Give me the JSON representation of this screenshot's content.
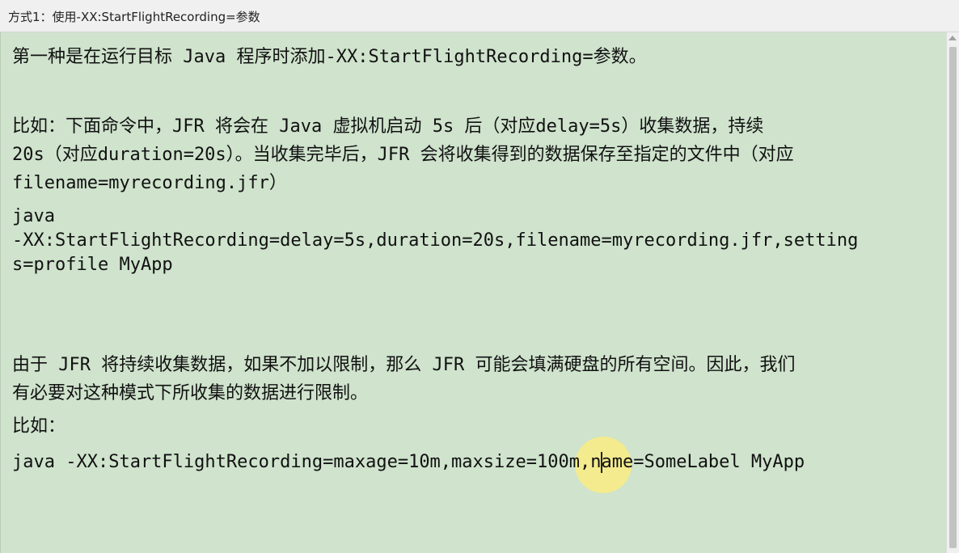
{
  "window": {
    "title": "方式1：使用-XX:StartFlightRecording=参数"
  },
  "content": {
    "lines": [
      "第一种是在运行目标 Java 程序时添加-XX:StartFlightRecording=参数。",
      "比如：下面命令中，JFR 将会在 Java 虚拟机启动 5s 后（对应delay=5s）收集数据，持续",
      "20s（对应duration=20s）。当收集完毕后，JFR 会将收集得到的数据保存至指定的文件中（对应",
      "filename=myrecording.jfr）",
      "java",
      "-XX:StartFlightRecording=delay=5s,duration=20s,filename=myrecording.jfr,setting",
      "s=profile MyApp",
      "由于 JFR 将持续收集数据，如果不加以限制，那么 JFR 可能会填满硬盘的所有空间。因此，我们",
      "有必要对这种模式下所收集的数据进行限制。",
      "比如：",
      "java -XX:StartFlightRecording=maxage=10m,maxsize=100m,name=SomeLabel MyApp"
    ]
  }
}
